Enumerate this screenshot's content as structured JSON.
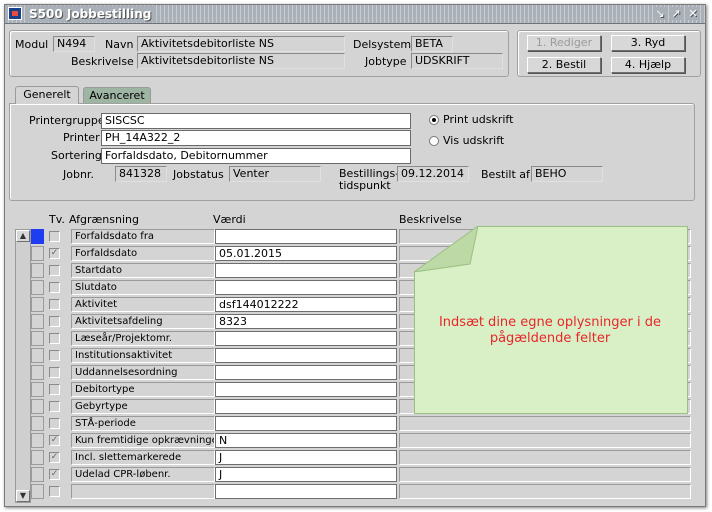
{
  "window": {
    "title": "S500 Jobbestilling"
  },
  "header": {
    "modul_label": "Modul",
    "modul_value": "N494",
    "navn_label": "Navn",
    "navn_value": "Aktivitetsdebitorliste NS",
    "beskrivelse_label": "Beskrivelse",
    "beskrivelse_value": "Aktivitetsdebitorliste NS",
    "delsystem_label": "Delsystem",
    "delsystem_value": "BETA",
    "jobtype_label": "Jobtype",
    "jobtype_value": "UDSKRIFT"
  },
  "buttons": {
    "rediger": "1. Rediger",
    "ryd": "3. Ryd",
    "bestil": "2. Bestil",
    "hjaelp": "4. Hjælp"
  },
  "tabs": [
    {
      "label": "Generelt"
    },
    {
      "label": "Avanceret"
    }
  ],
  "general": {
    "printergruppe_label": "Printergruppe",
    "printergruppe_value": "SISCSC",
    "printer_label": "Printer",
    "printer_value": "PH_14A322_2",
    "sortering_label": "Sortering",
    "sortering_value": "Forfaldsdato, Debitornummer",
    "jobnr_label": "Jobnr.",
    "jobnr_value": "841328",
    "jobstatus_label": "Jobstatus",
    "jobstatus_value": "Venter",
    "bestillings_label_1": "Bestillings-",
    "bestillings_label_2": "tidspunkt",
    "bestillings_value": "09.12.2014",
    "bestiltaf_label": "Bestilt af",
    "bestiltaf_value": "BEHO",
    "radio_print": "Print udskrift",
    "radio_vis": "Vis udskrift"
  },
  "grid": {
    "col_tv": "Tv.",
    "col_afgraensning": "Afgrænsning",
    "col_vaerdi": "Værdi",
    "col_beskrivelse": "Beskrivelse",
    "rows": [
      {
        "label": "Forfaldsdato fra",
        "value": "",
        "checked": false
      },
      {
        "label": "Forfaldsdato",
        "value": "05.01.2015",
        "checked": true
      },
      {
        "label": "Startdato",
        "value": "",
        "checked": false
      },
      {
        "label": "Slutdato",
        "value": "",
        "checked": false
      },
      {
        "label": "Aktivitet",
        "value": "dsf144012222",
        "checked": false
      },
      {
        "label": "Aktivitetsafdeling",
        "value": "8323",
        "checked": false
      },
      {
        "label": "Læseår/Projektomr.",
        "value": "",
        "checked": false
      },
      {
        "label": "Institutionsaktivitet",
        "value": "",
        "checked": false
      },
      {
        "label": "Uddannelsesordning",
        "value": "",
        "checked": false
      },
      {
        "label": "Debitortype",
        "value": "",
        "checked": false
      },
      {
        "label": "Gebyrtype",
        "value": "",
        "checked": false
      },
      {
        "label": "STÅ-periode",
        "value": "",
        "checked": false
      },
      {
        "label": "Kun fremtidige opkrævninger",
        "value": "N",
        "checked": true
      },
      {
        "label": "Incl. slettemarkerede",
        "value": "J",
        "checked": true
      },
      {
        "label": "Udelad CPR-løbenr.",
        "value": "J",
        "checked": true
      },
      {
        "label": "",
        "value": "",
        "checked": false
      }
    ]
  },
  "note": {
    "text": "Indsæt dine egne oplysninger i de pågældende felter"
  }
}
